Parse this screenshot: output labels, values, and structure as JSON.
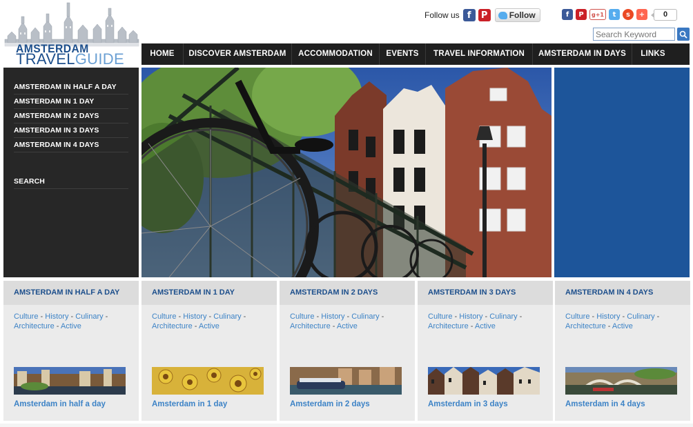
{
  "logo": {
    "line1": "AMSTERDAM",
    "line2_a": "TRAVEL",
    "line2_b": "GUIDE"
  },
  "social_follow": {
    "label": "Follow us",
    "twitter_button": "Follow"
  },
  "share": {
    "count": "0"
  },
  "search": {
    "placeholder": "Search Keyword"
  },
  "nav": {
    "items": [
      {
        "label": "HOME"
      },
      {
        "label": "DISCOVER AMSTERDAM"
      },
      {
        "label": "ACCOMMODATION"
      },
      {
        "label": "EVENTS"
      },
      {
        "label": "TRAVEL INFORMATION"
      },
      {
        "label": "AMSTERDAM IN DAYS"
      },
      {
        "label": "LINKS"
      }
    ]
  },
  "sidebar": {
    "items": [
      {
        "label": "AMSTERDAM IN HALF A DAY"
      },
      {
        "label": "AMSTERDAM IN 1 DAY"
      },
      {
        "label": "AMSTERDAM IN 2 DAYS"
      },
      {
        "label": "AMSTERDAM IN 3 DAYS"
      },
      {
        "label": "AMSTERDAM IN 4 DAYS"
      }
    ],
    "search_label": "SEARCH"
  },
  "cards": [
    {
      "title": "AMSTERDAM IN HALF A DAY",
      "links": [
        "Culture",
        "History",
        "Culinary",
        "Architecture",
        "Active"
      ],
      "caption": "Amsterdam in half a day"
    },
    {
      "title": "AMSTERDAM IN 1 DAY",
      "links": [
        "Culture",
        "History",
        "Culinary",
        "Architecture",
        "Active"
      ],
      "caption": "Amsterdam in 1 day"
    },
    {
      "title": "AMSTERDAM IN 2 DAYS",
      "links": [
        "Culture",
        "History",
        "Culinary",
        "Architecture",
        "Active"
      ],
      "caption": "Amsterdam in 2 days"
    },
    {
      "title": "AMSTERDAM IN 3 DAYS",
      "links": [
        "Culture",
        "History",
        "Culinary",
        "Architecture",
        "Active"
      ],
      "caption": "Amsterdam in 3 days"
    },
    {
      "title": "AMSTERDAM IN 4 DAYS",
      "links": [
        "Culture",
        "History",
        "Culinary",
        "Architecture",
        "Active"
      ],
      "caption": "Amsterdam in 4 days"
    }
  ],
  "colors": {
    "nav_bg": "#1f1f1f",
    "sidebar_bg": "#272727",
    "accent_blue": "#1d559a",
    "link_blue": "#3d83c6",
    "card_bg": "#ebebeb"
  }
}
